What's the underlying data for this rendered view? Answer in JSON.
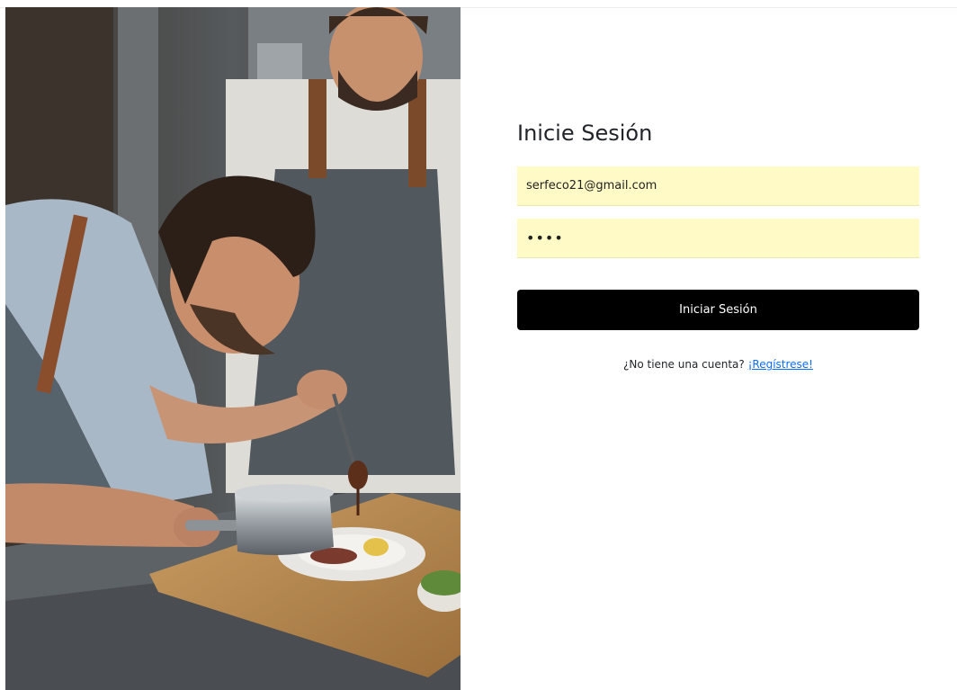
{
  "login": {
    "title": "Inicie Sesión",
    "email_value": "serfeco21@gmail.com",
    "password_value": "••••",
    "submit_label": "Iniciar Sesión",
    "no_account_text": "¿No tiene una cuenta?",
    "register_link": "¡Regístrese!"
  },
  "photo": {
    "subject": "chefs plating a dish"
  },
  "colors": {
    "input_autofill_bg": "#fffac6",
    "button_bg": "#000000",
    "link": "#0d6efd"
  }
}
